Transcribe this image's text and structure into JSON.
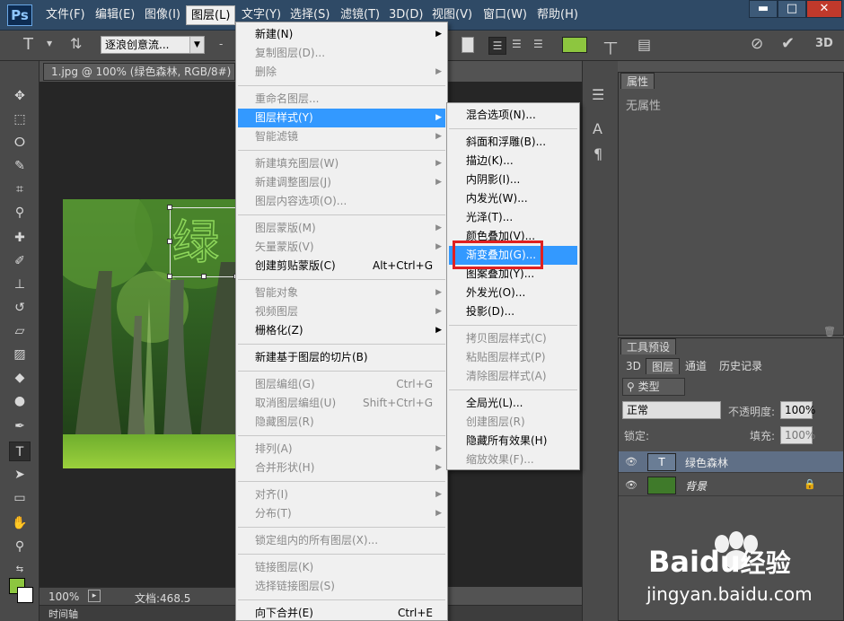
{
  "app": {
    "logo": "Ps"
  },
  "menubar": {
    "items": [
      "文件(F)",
      "编辑(E)",
      "图像(I)",
      "图层(L)",
      "文字(Y)",
      "选择(S)",
      "滤镜(T)",
      "3D(D)",
      "视图(V)",
      "窗口(W)",
      "帮助(H)"
    ],
    "active": "图层(L)"
  },
  "window_controls": {
    "minimize": "▬",
    "restore": "□",
    "close": "✕"
  },
  "options_bar": {
    "font_family": "逐浪创意流...",
    "dash": "-",
    "text_color": "#8dc63f"
  },
  "document": {
    "tab_title": "1.jpg @ 100% (绿色森林, RGB/8#) *",
    "canvas_text": "绿",
    "zoom": "100%",
    "doc_size": "文档:468.5 K/624.6K",
    "timeline_label": "时间轴"
  },
  "properties_panel": {
    "tab": "属性",
    "empty_text": "无属性"
  },
  "layers_panel": {
    "preset_tab": "工具预设",
    "tabs": [
      "3D",
      "图层",
      "通道",
      "历史记录"
    ],
    "active_tab": "图层",
    "filter_type": "类型",
    "blend_mode": "正常",
    "opacity_label": "不透明度:",
    "opacity_value": "100%",
    "lock_label": "锁定:",
    "fill_label": "填充:",
    "fill_value": "100%",
    "layers": [
      {
        "name": "绿色森林",
        "kind": "text",
        "selected": true
      },
      {
        "name": "背景",
        "kind": "image",
        "selected": false
      }
    ]
  },
  "layer_menu": [
    {
      "label": "新建(N)",
      "submenu": true
    },
    {
      "label": "复制图层(D)...",
      "disabled": true
    },
    {
      "label": "删除",
      "disabled": true,
      "submenu": true
    },
    {
      "separator": true
    },
    {
      "label": "重命名图层...",
      "disabled": true
    },
    {
      "label": "图层样式(Y)",
      "submenu": true,
      "highlighted": true
    },
    {
      "label": "智能滤镜",
      "disabled": true,
      "submenu": true
    },
    {
      "separator": true
    },
    {
      "label": "新建填充图层(W)",
      "disabled": true,
      "submenu": true
    },
    {
      "label": "新建调整图层(J)",
      "disabled": true,
      "submenu": true
    },
    {
      "label": "图层内容选项(O)...",
      "disabled": true
    },
    {
      "separator": true
    },
    {
      "label": "图层蒙版(M)",
      "disabled": true,
      "submenu": true
    },
    {
      "label": "矢量蒙版(V)",
      "disabled": true,
      "submenu": true
    },
    {
      "label": "创建剪贴蒙版(C)",
      "shortcut": "Alt+Ctrl+G"
    },
    {
      "separator": true
    },
    {
      "label": "智能对象",
      "disabled": true,
      "submenu": true
    },
    {
      "label": "视频图层",
      "disabled": true,
      "submenu": true
    },
    {
      "label": "栅格化(Z)",
      "submenu": true
    },
    {
      "separator": true
    },
    {
      "label": "新建基于图层的切片(B)"
    },
    {
      "separator": true
    },
    {
      "label": "图层编组(G)",
      "disabled": true,
      "shortcut": "Ctrl+G"
    },
    {
      "label": "取消图层编组(U)",
      "disabled": true,
      "shortcut": "Shift+Ctrl+G"
    },
    {
      "label": "隐藏图层(R)",
      "disabled": true
    },
    {
      "separator": true
    },
    {
      "label": "排列(A)",
      "disabled": true,
      "submenu": true
    },
    {
      "label": "合并形状(H)",
      "disabled": true,
      "submenu": true
    },
    {
      "separator": true
    },
    {
      "label": "对齐(I)",
      "disabled": true,
      "submenu": true
    },
    {
      "label": "分布(T)",
      "disabled": true,
      "submenu": true
    },
    {
      "separator": true
    },
    {
      "label": "锁定组内的所有图层(X)...",
      "disabled": true
    },
    {
      "separator": true
    },
    {
      "label": "链接图层(K)",
      "disabled": true
    },
    {
      "label": "选择链接图层(S)",
      "disabled": true
    },
    {
      "separator": true
    },
    {
      "label": "向下合并(E)",
      "shortcut": "Ctrl+E"
    }
  ],
  "style_submenu": [
    {
      "label": "混合选项(N)..."
    },
    {
      "separator": true
    },
    {
      "label": "斜面和浮雕(B)..."
    },
    {
      "label": "描边(K)..."
    },
    {
      "label": "内阴影(I)..."
    },
    {
      "label": "内发光(W)..."
    },
    {
      "label": "光泽(T)..."
    },
    {
      "label": "颜色叠加(V)..."
    },
    {
      "label": "渐变叠加(G)...",
      "highlighted": true
    },
    {
      "label": "图案叠加(Y)..."
    },
    {
      "label": "外发光(O)..."
    },
    {
      "label": "投影(D)..."
    },
    {
      "separator": true
    },
    {
      "label": "拷贝图层样式(C)",
      "disabled": true
    },
    {
      "label": "粘贴图层样式(P)",
      "disabled": true
    },
    {
      "label": "清除图层样式(A)",
      "disabled": true
    },
    {
      "separator": true
    },
    {
      "label": "全局光(L)..."
    },
    {
      "label": "创建图层(R)",
      "disabled": true
    },
    {
      "label": "隐藏所有效果(H)"
    },
    {
      "label": "缩放效果(F)...",
      "disabled": true
    }
  ],
  "watermark": {
    "brand": "Baidu",
    "brand_cn": "经验",
    "url": "jingyan.baidu.com"
  },
  "colors": {
    "highlight": "#3399ff",
    "accent_green": "#8dc63f",
    "callout_red": "#e02020"
  }
}
